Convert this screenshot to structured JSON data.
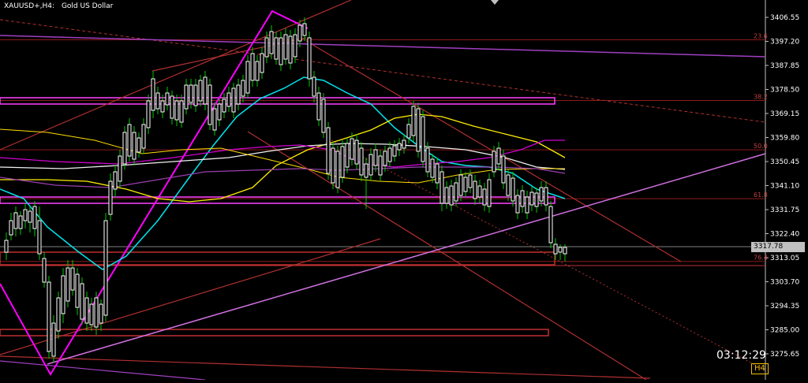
{
  "header": {
    "symbol": "XAUUSD+,H4:",
    "description": "Gold US Dollar"
  },
  "timer": "03:12:29",
  "timeframe_badge": "H4",
  "current_price": "3317.78",
  "colors": {
    "background": "#000000",
    "bull_candle": "#ffffff",
    "bear_candle": "#ffffff",
    "wick": "#00c800",
    "fib_line": "#8b1a1a",
    "channel": "#b03030",
    "zigzag": "#ff00ff",
    "ma_cyan": "#00e5ee",
    "ma_yellow": "#ffee00",
    "ma_white": "#f0f0f0",
    "ma_magenta": "#d000d0",
    "trend_violet": "#c060e0"
  },
  "chart_data": {
    "type": "candlestick",
    "symbol": "XAUUSD+",
    "timeframe": "H4",
    "ylim": [
      3270,
      3412
    ],
    "price_axis_labels": [
      "3406.55",
      "3397.20",
      "3387.85",
      "3378.50",
      "3369.15",
      "3359.80",
      "3350.45",
      "3341.10",
      "3331.75",
      "3322.40",
      "3313.05",
      "3303.70",
      "3294.35",
      "3285.00",
      "3275.65"
    ],
    "fib_levels": [
      {
        "label": "23.6",
        "price": 3397.8
      },
      {
        "label": "38.2",
        "price": 3374.2
      },
      {
        "label": "50.0",
        "price": 3355.0
      },
      {
        "label": "61.8",
        "price": 3336.0
      },
      {
        "label": "76.4",
        "price": 3311.6
      }
    ],
    "last_price": 3317.78
  }
}
